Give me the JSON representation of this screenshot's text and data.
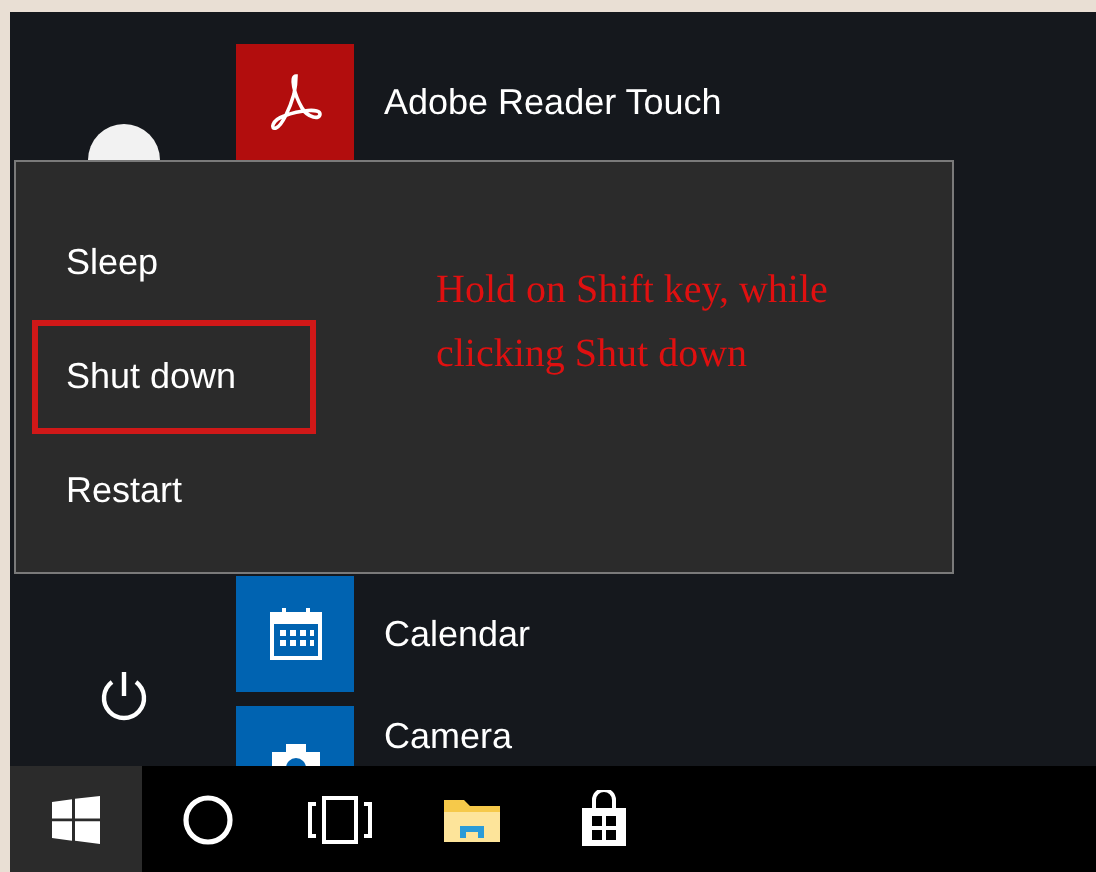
{
  "start_menu": {
    "apps": [
      {
        "name": "Adobe Reader Touch",
        "kind": "acrobat"
      },
      {
        "name": "Calendar",
        "kind": "calendar"
      },
      {
        "name": "Camera",
        "kind": "camera"
      }
    ]
  },
  "power_menu": {
    "items": [
      {
        "label": "Sleep",
        "marked": false
      },
      {
        "label": "Shut down",
        "marked": true
      },
      {
        "label": "Restart",
        "marked": false
      }
    ],
    "annotation": "Hold on Shift key, while clicking Shut down"
  },
  "taskbar": {
    "icons": [
      {
        "kind": "start"
      },
      {
        "kind": "cortana"
      },
      {
        "kind": "taskview"
      },
      {
        "kind": "explorer"
      },
      {
        "kind": "store"
      }
    ]
  }
}
